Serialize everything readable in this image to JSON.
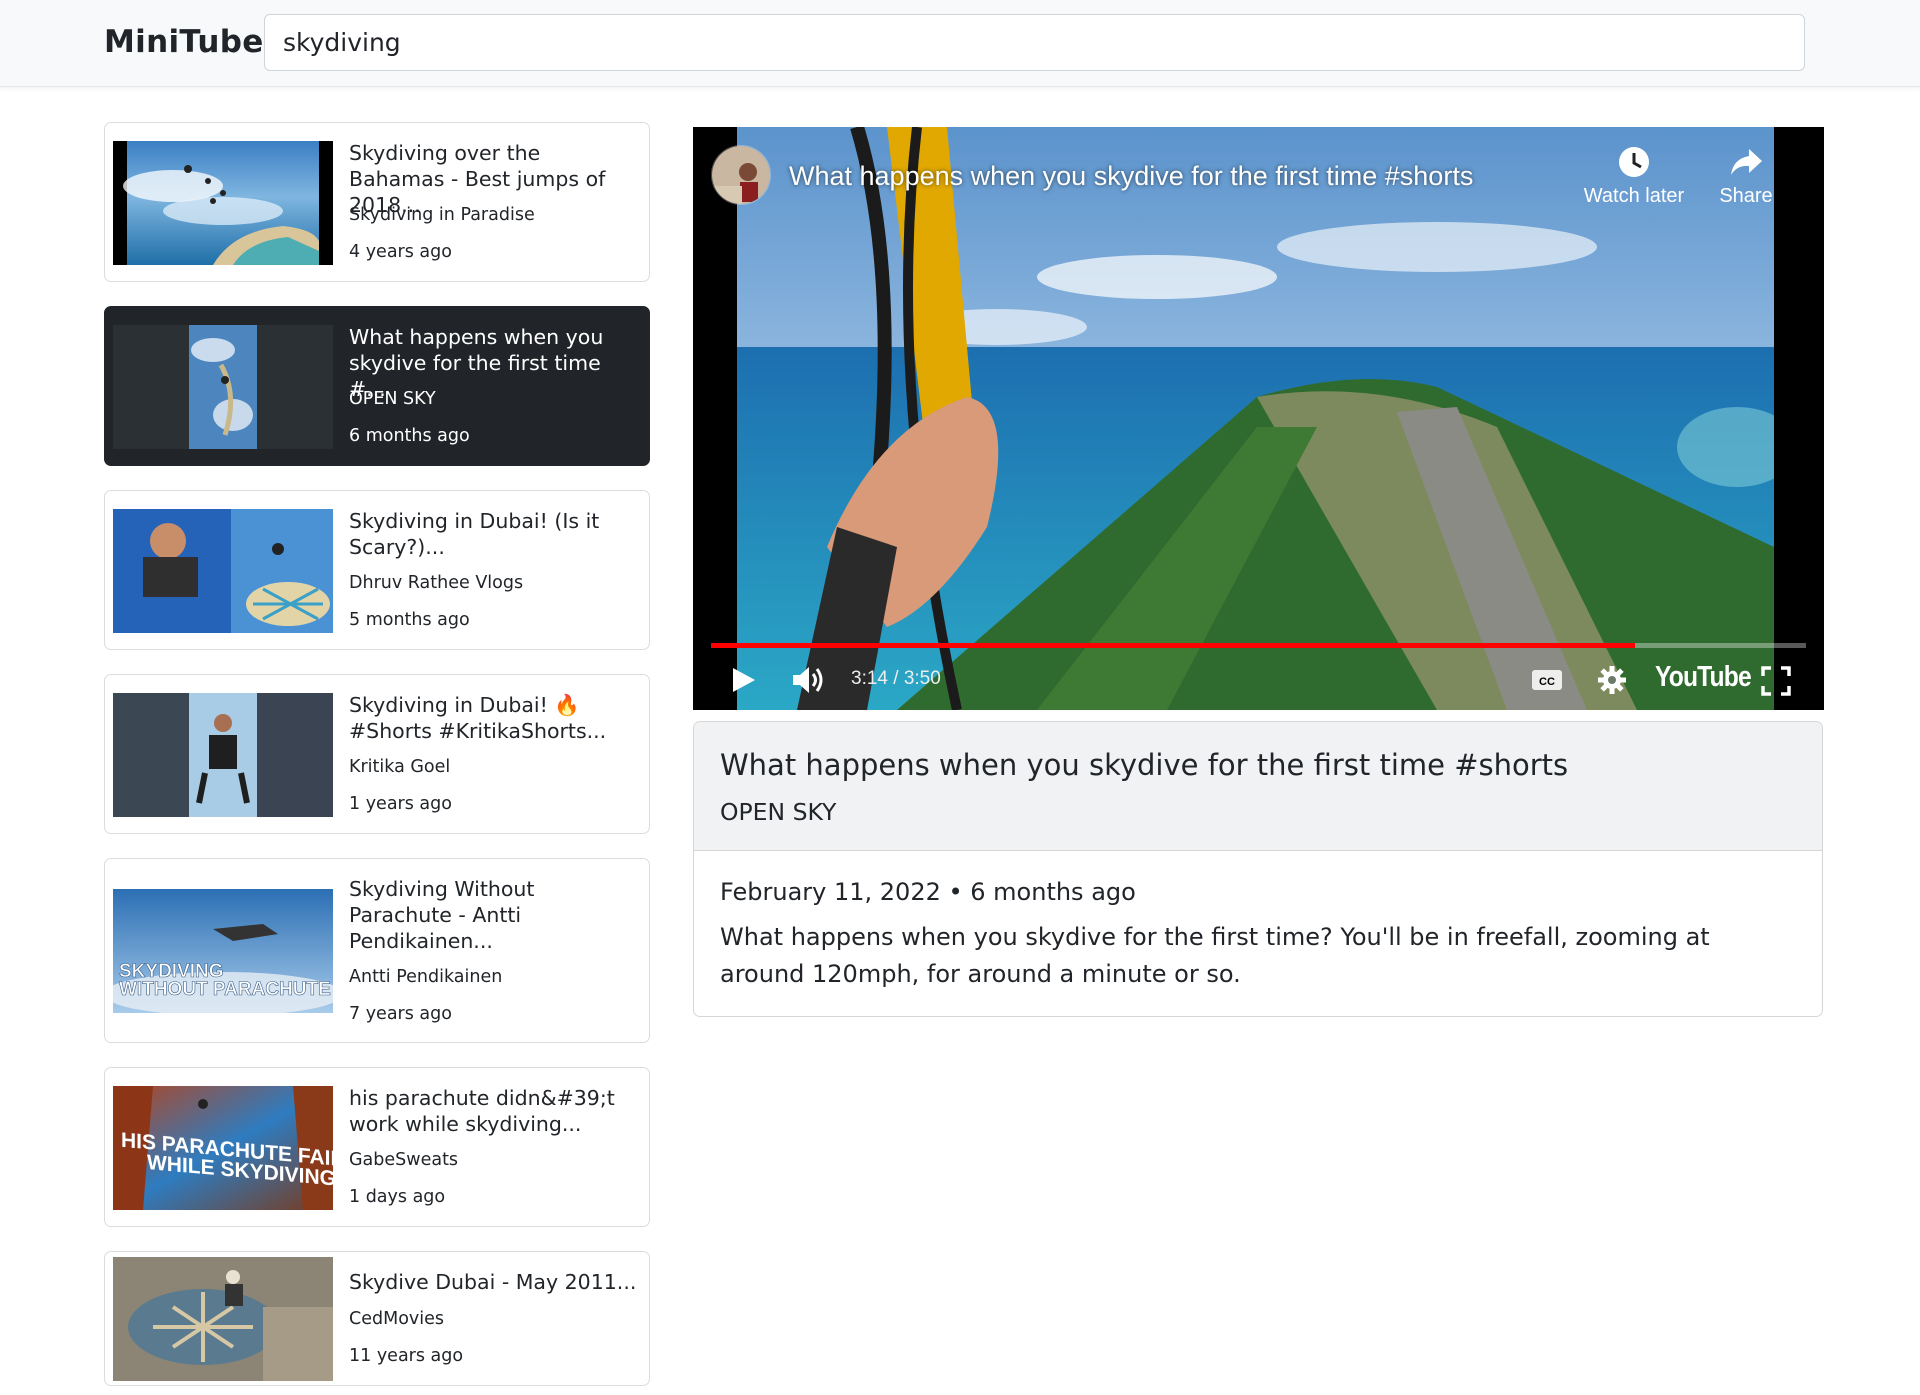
{
  "app": {
    "brand": "MiniTube"
  },
  "search": {
    "value": "skydiving"
  },
  "videos": [
    {
      "title": "Skydiving over the Bahamas - Best jumps of 2018...",
      "channel": "Skydiving in Paradise",
      "age": "4 years ago",
      "active": false
    },
    {
      "title": "What happens when you skydive for the first time #...",
      "channel": "OPEN SKY",
      "age": "6 months ago",
      "active": true
    },
    {
      "title": "Skydiving in Dubai! (Is it Scary?)...",
      "channel": "Dhruv Rathee Vlogs",
      "age": "5 months ago",
      "active": false
    },
    {
      "title": "Skydiving in Dubai! 🔥 #Shorts #KritikaShorts...",
      "channel": "Kritika Goel",
      "age": "1 years ago",
      "active": false
    },
    {
      "title": "Skydiving Without Parachute - Antti Pendikainen...",
      "channel": "Antti Pendikainen",
      "age": "7 years ago",
      "active": false
    },
    {
      "title": "his parachute didn&#39;t work while skydiving...",
      "channel": "GabeSweats",
      "age": "1 days ago",
      "active": false
    },
    {
      "title": "Skydive Dubai - May 2011...",
      "channel": "CedMovies",
      "age": "11 years ago",
      "active": false
    }
  ],
  "thumbnail_text": {
    "without_parachute": [
      "SKYDIVING",
      "WITHOUT PARACHUTE"
    ],
    "parachute_failed": [
      "HIS PARACHUTE FAILED",
      "WHILE SKYDIVING"
    ]
  },
  "player": {
    "title": "What happens when you skydive for the first time #shorts",
    "watch_later_label": "Watch later",
    "share_label": "Share",
    "time_display": "3:14 / 3:50",
    "progress_fraction": 0.8435,
    "logo_text": "YouTube",
    "accent": "#ff0000"
  },
  "details": {
    "title": "What happens when you skydive for the first time #shorts",
    "channel": "OPEN SKY",
    "date_line": "February 11, 2022 • 6 months ago",
    "description": "What happens when you skydive for the first time? You'll be in freefall, zooming at around 120mph, for around a minute or so."
  },
  "icons": {
    "play": "play-icon",
    "volume": "volume-icon",
    "captions": "cc-icon",
    "settings": "gear-icon",
    "fullscreen": "fullscreen-icon",
    "watch_later": "clock-icon",
    "share": "share-arrow-icon"
  }
}
